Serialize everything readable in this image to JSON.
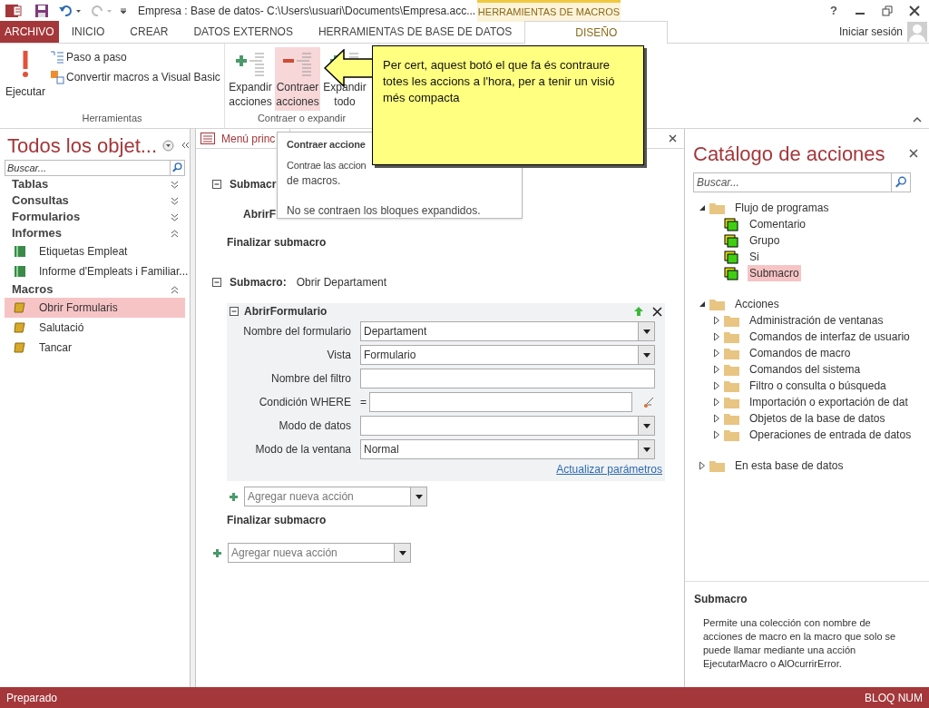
{
  "title_bar": {
    "title": "Empresa : Base de datos- C:\\Users\\usuari\\Documents\\Empresa.acc...",
    "context_group": "HERRAMIENTAS DE MACROS",
    "help": "?"
  },
  "ribbon_tabs": [
    {
      "label": "ARCHIVO",
      "kind": "file",
      "selected": false
    },
    {
      "label": "INICIO",
      "kind": "tab",
      "selected": false
    },
    {
      "label": "CREAR",
      "kind": "tab",
      "selected": false
    },
    {
      "label": "DATOS EXTERNOS",
      "kind": "tab",
      "selected": false
    },
    {
      "label": "HERRAMIENTAS DE BASE DE DATOS",
      "kind": "tab",
      "selected": false
    },
    {
      "label": "DISEÑO",
      "kind": "context",
      "selected": true
    }
  ],
  "sign_in": "Iniciar sesión",
  "ribbon_groups": [
    {
      "label": "Herramientas",
      "buttons": [
        {
          "label": "Ejecutar",
          "kind": "run",
          "highlighted": false
        },
        {
          "label": "Paso a paso",
          "kind": "step",
          "highlighted": false
        },
        {
          "label": "Convertir macros a Visual Basic",
          "kind": "convert",
          "highlighted": false
        }
      ]
    },
    {
      "label": "Contraer o expandir",
      "buttons": [
        {
          "label": "Expandir acciones",
          "kind": "expand",
          "highlighted": false
        },
        {
          "label": "Contraer acciones",
          "kind": "collapse",
          "highlighted": true
        },
        {
          "label": "Expandir todo",
          "kind": "expand",
          "highlighted": false
        }
      ]
    }
  ],
  "nav_pane": {
    "title": "Todos los objet...",
    "search_placeholder": "Buscar...",
    "groups": [
      {
        "label": "Tablas",
        "expanded": false
      },
      {
        "label": "Consultas",
        "expanded": false
      },
      {
        "label": "Formularios",
        "expanded": false
      },
      {
        "label": "Informes",
        "expanded": true,
        "items": [
          {
            "label": "Etiquetas Empleat",
            "kind": "report",
            "selected": false
          },
          {
            "label": "Informe d'Empleats i Familiar...",
            "kind": "report",
            "selected": false
          }
        ]
      },
      {
        "label": "Macros",
        "expanded": true,
        "items": [
          {
            "label": "Obrir Formularis",
            "kind": "macro",
            "selected": true
          },
          {
            "label": "Salutació",
            "kind": "macro",
            "selected": false
          },
          {
            "label": "Tancar",
            "kind": "macro",
            "selected": false
          }
        ]
      }
    ]
  },
  "document": {
    "tab_label": "Menú princ",
    "submacros": [
      {
        "label": "Submacr",
        "expanded": true,
        "actions": [
          {
            "name": "AbrirF",
            "expanded": false
          }
        ],
        "end": "Finalizar submacro"
      },
      {
        "label": "Submacro:",
        "name": "Obrir Departament",
        "expanded": true,
        "actions": [
          {
            "name": "AbrirFormulario",
            "expanded": true,
            "params": [
              {
                "label": "Nombre del formulario",
                "kind": "dropdown",
                "value": "Departament"
              },
              {
                "label": "Vista",
                "kind": "dropdown",
                "value": "Formulario"
              },
              {
                "label": "Nombre del filtro",
                "kind": "text"
              },
              {
                "label": "Condición WHERE",
                "kind": "expression",
                "prefix": "="
              },
              {
                "label": "Modo de datos",
                "kind": "dropdown"
              },
              {
                "label": "Modo de la ventana",
                "kind": "dropdown",
                "value": "Normal"
              }
            ],
            "link": "Actualizar parámetros"
          }
        ],
        "add_action": "Agregar nueva acción",
        "end": "Finalizar submacro"
      }
    ],
    "add_action": "Agregar nueva acción"
  },
  "tooltip": {
    "title": "Contraer accione",
    "lines": [
      "Contrae las accion",
      "de macros.",
      "No se contraen los bloques expandidos."
    ]
  },
  "callout": {
    "text": "Per cert, aquest botó el que fa és contraure totes les accions a l'hora, per a tenir un visió més compacta"
  },
  "catalog": {
    "title": "Catálogo de acciones",
    "search_placeholder": "Buscar...",
    "tree": [
      {
        "label": "Flujo de programas",
        "kind": "folder",
        "expanded": true,
        "children": [
          {
            "label": "Comentario",
            "kind": "action",
            "selected": false
          },
          {
            "label": "Grupo",
            "kind": "action",
            "selected": false
          },
          {
            "label": "Si",
            "kind": "action",
            "selected": false
          },
          {
            "label": "Submacro",
            "kind": "action",
            "selected": true
          }
        ]
      },
      {
        "label": "Acciones",
        "kind": "folder",
        "expanded": true,
        "children": [
          {
            "label": "Administración de ventanas",
            "kind": "folder",
            "expanded": false
          },
          {
            "label": "Comandos de interfaz de usuario",
            "kind": "folder",
            "expanded": false
          },
          {
            "label": "Comandos de macro",
            "kind": "folder",
            "expanded": false
          },
          {
            "label": "Comandos del sistema",
            "kind": "folder",
            "expanded": false
          },
          {
            "label": "Filtro o consulta o búsqueda",
            "kind": "folder",
            "expanded": false
          },
          {
            "label": "Importación o exportación de dat",
            "kind": "folder",
            "expanded": false
          },
          {
            "label": "Objetos de la base de datos",
            "kind": "folder",
            "expanded": false
          },
          {
            "label": "Operaciones de entrada de datos",
            "kind": "folder",
            "expanded": false
          }
        ]
      },
      {
        "label": "En esta base de datos",
        "kind": "folder",
        "expanded": false
      }
    ],
    "description": {
      "title": "Submacro",
      "text": "Permite una colección con nombre de acciones de macro en la macro que solo se puede llamar mediante una acción EjecutarMacro o AlOcurrirError."
    }
  },
  "status_bar": {
    "left": "Preparado",
    "right": "BLOQ NUM"
  }
}
